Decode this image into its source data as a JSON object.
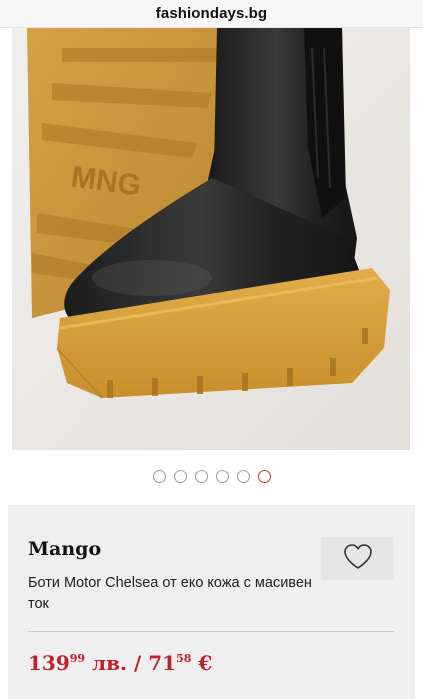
{
  "browser": {
    "url": "fashiondays.bg"
  },
  "gallery": {
    "image_brand_mark": "MNG",
    "slides_total": 6,
    "active_slide": 6
  },
  "product": {
    "brand": "Mango",
    "title": "Боти Motor Chelsea от еко кожа с масивен ток",
    "price": {
      "bgn_main": "139",
      "bgn_decimals": "99",
      "bgn_currency": "лв.",
      "separator": "/",
      "eur_main": "71",
      "eur_decimals": "58",
      "eur_currency": "€"
    }
  },
  "icons": {
    "wishlist": "heart-icon"
  },
  "colors": {
    "price": "#c0202e",
    "active_dot": "#c0392b",
    "sole": "#d9a441",
    "card_bg": "#efefef"
  }
}
